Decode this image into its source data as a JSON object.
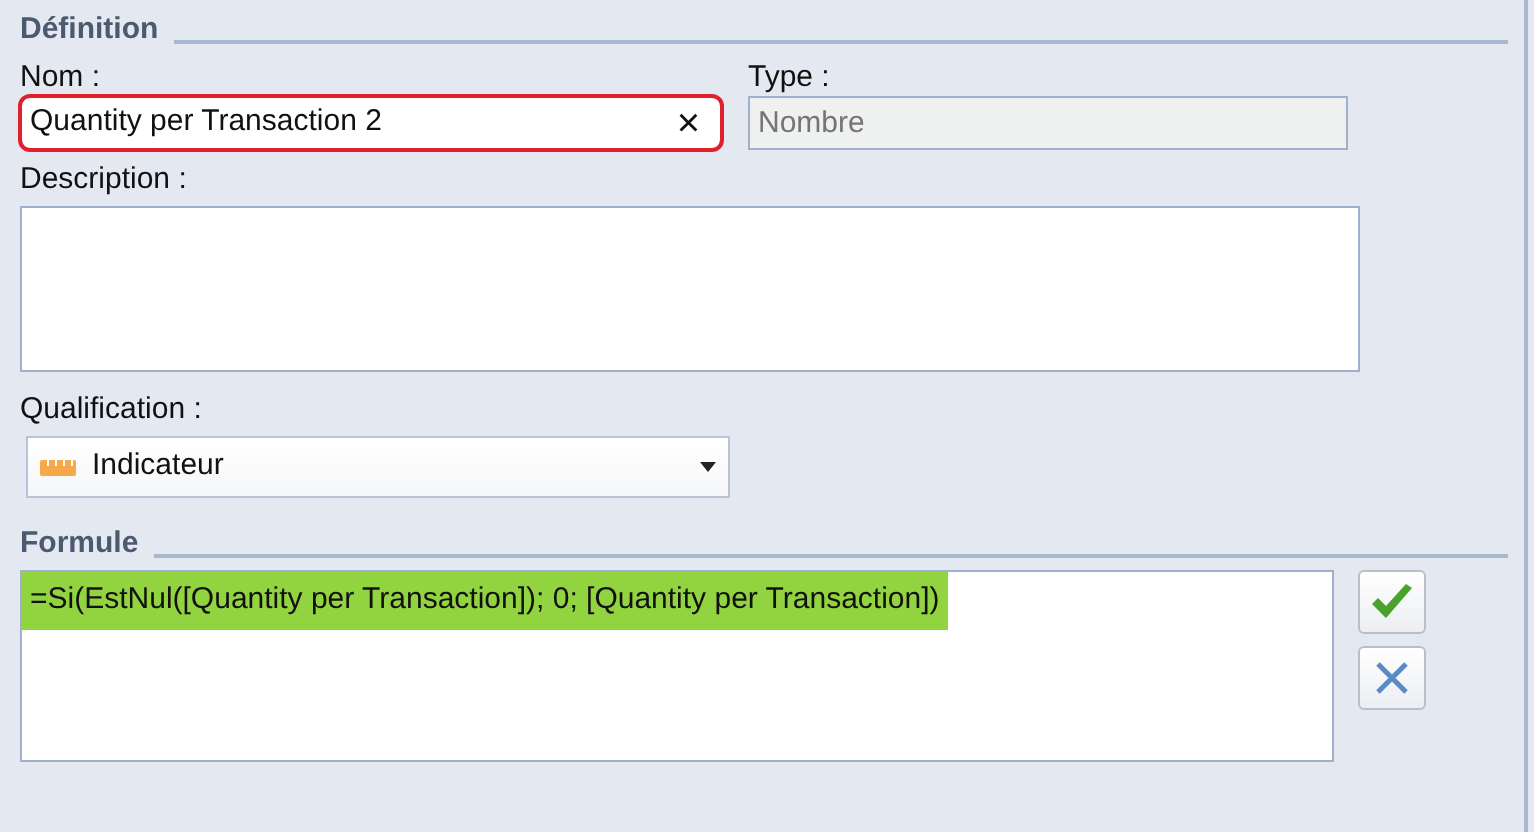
{
  "definition": {
    "title": "Définition",
    "name": {
      "label": "Nom :",
      "value": "Quantity per Transaction 2",
      "highlighted": true,
      "clear": "×"
    },
    "type": {
      "label": "Type :",
      "placeholder": "Nombre",
      "disabled": true
    },
    "description": {
      "label": "Description :"
    },
    "qualification": {
      "label": "Qualification :",
      "value": "Indicateur"
    }
  },
  "formula": {
    "title": "Formule",
    "value": "=Si(EstNul([Quantity per Transaction]); 0; [Quantity per Transaction])",
    "highlighted": true
  }
}
